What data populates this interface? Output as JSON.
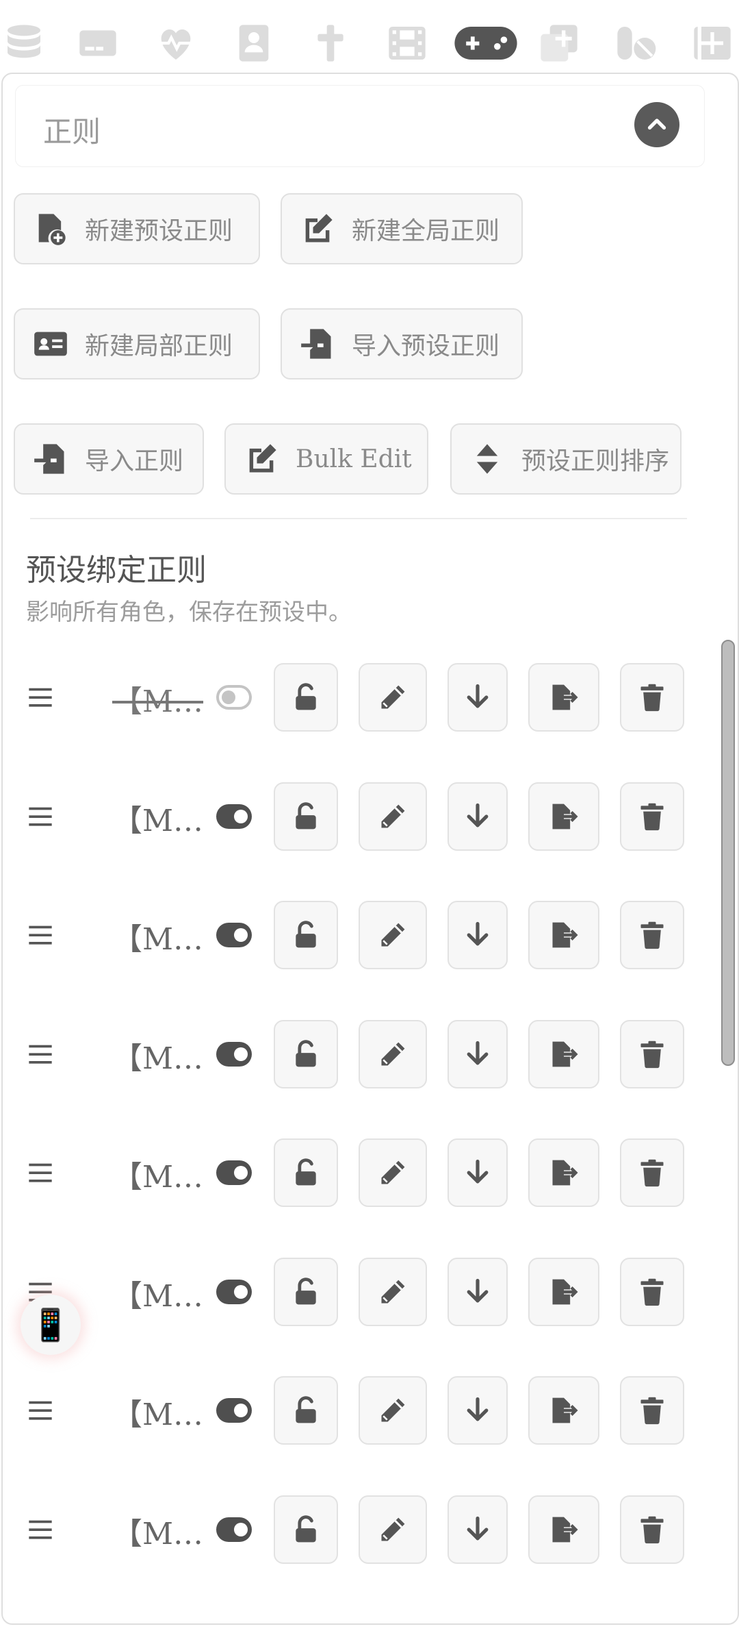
{
  "top_icons": [
    "database-icon",
    "credit-card-icon",
    "heart-pulse-icon",
    "address-book-icon",
    "cross-icon",
    "film-icon",
    "gamepad-icon",
    "copy-plus-icon",
    "pills-icon",
    "square-plus-icon"
  ],
  "drawer": {
    "title": "正则",
    "toggle_icon": "chevron-up-icon"
  },
  "actions": {
    "new_preset": "新建预设正则",
    "new_global": "新建全局正则",
    "new_local": "新建局部正则",
    "import_preset": "导入预设正则",
    "import": "导入正则",
    "bulk_edit": "Bulk Edit",
    "sort_preset": "预设正则排序"
  },
  "section": {
    "title": "预设绑定正则",
    "description": "影响所有角色，保存在预设中。"
  },
  "rules": [
    {
      "name": "【M…",
      "enabled": false
    },
    {
      "name": "【M…",
      "enabled": true
    },
    {
      "name": "【M…",
      "enabled": true
    },
    {
      "name": "【M…",
      "enabled": true
    },
    {
      "name": "【M…",
      "enabled": true
    },
    {
      "name": "【M…",
      "enabled": true
    },
    {
      "name": "【M…",
      "enabled": true
    },
    {
      "name": "【M…",
      "enabled": true
    }
  ],
  "floating_button": "📱",
  "colors": {
    "icon": "#5a5a5a",
    "muted_icon": "#dcdcdc",
    "button_bg": "#f7f7f7"
  }
}
